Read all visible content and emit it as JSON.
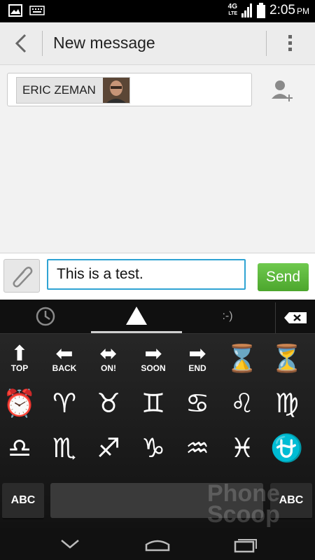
{
  "status_bar": {
    "network": "4G",
    "network_sub": "LTE",
    "time": "2:05",
    "ampm": "PM",
    "icons": [
      "gallery-notification-icon",
      "keyboard-notification-icon",
      "signal-icon",
      "battery-icon"
    ]
  },
  "app_bar": {
    "title": "New message"
  },
  "recipient": {
    "name": "ERIC ZEMAN"
  },
  "composer": {
    "message": "This is a test.",
    "send_label": "Send"
  },
  "keyboard": {
    "tabs": [
      {
        "icon": "recent-clock-icon"
      },
      {
        "icon": "symbols-triangle-icon",
        "active": true
      },
      {
        "label": ":-)"
      }
    ],
    "keys": [
      {
        "glyph": "⬆",
        "label": "TOP",
        "name": "top-arrow"
      },
      {
        "glyph": "⬅",
        "label": "BACK",
        "name": "back-arrow"
      },
      {
        "glyph": "⬌",
        "label": "ON!",
        "name": "on-arrow"
      },
      {
        "glyph": "➡",
        "label": "SOON",
        "name": "soon-arrow"
      },
      {
        "glyph": "➡",
        "label": "END",
        "name": "end-arrow"
      },
      {
        "glyph": "⌛",
        "label": "",
        "name": "hourglass"
      },
      {
        "glyph": "⏳",
        "label": "",
        "name": "hourglass-flowing"
      },
      {
        "glyph": "⏰",
        "label": "",
        "name": "alarm-clock"
      },
      {
        "glyph": "♈",
        "label": "",
        "name": "aries"
      },
      {
        "glyph": "♉",
        "label": "",
        "name": "taurus"
      },
      {
        "glyph": "♊",
        "label": "",
        "name": "gemini"
      },
      {
        "glyph": "♋",
        "label": "",
        "name": "cancer"
      },
      {
        "glyph": "♌",
        "label": "",
        "name": "leo"
      },
      {
        "glyph": "♍",
        "label": "",
        "name": "virgo"
      },
      {
        "glyph": "♎",
        "label": "",
        "name": "libra"
      },
      {
        "glyph": "♏",
        "label": "",
        "name": "scorpio"
      },
      {
        "glyph": "♐",
        "label": "",
        "name": "sagittarius"
      },
      {
        "glyph": "♑",
        "label": "",
        "name": "capricorn"
      },
      {
        "glyph": "♒",
        "label": "",
        "name": "aquarius"
      },
      {
        "glyph": "♓",
        "label": "",
        "name": "pisces"
      },
      {
        "glyph": "⛎",
        "label": "",
        "name": "ophiuchus"
      }
    ],
    "abc_left": "ABC",
    "abc_right": "ABC"
  },
  "watermark": {
    "text": "Phone Scoop"
  }
}
